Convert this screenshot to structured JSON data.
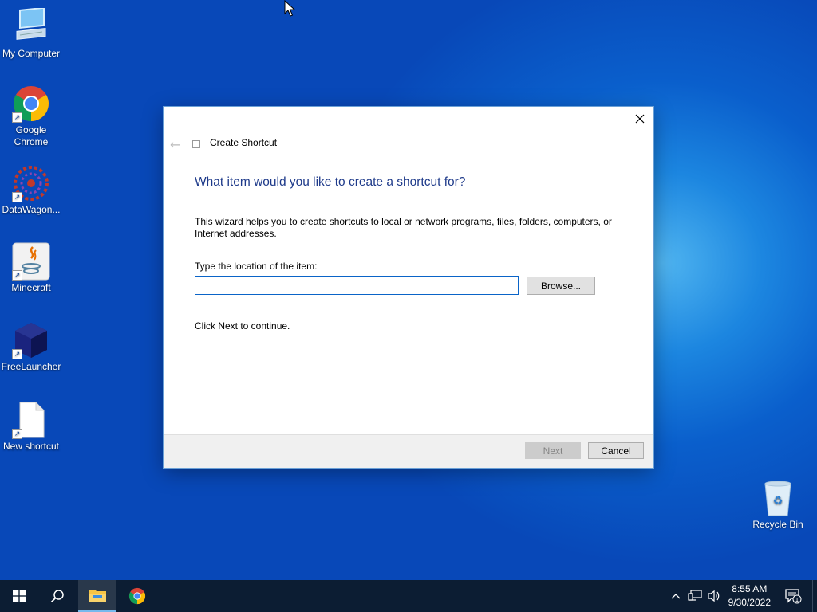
{
  "desktop": {
    "icons": [
      {
        "label": "My Computer",
        "icon": "computer-icon"
      },
      {
        "label": "Google Chrome",
        "icon": "chrome-icon"
      },
      {
        "label": "DataWagon...",
        "icon": "datawagon-icon"
      },
      {
        "label": "Minecraft",
        "icon": "java-icon"
      },
      {
        "label": "FreeLauncher",
        "icon": "cube-icon"
      },
      {
        "label": "New shortcut",
        "icon": "file-icon"
      },
      {
        "label": "Recycle Bin",
        "icon": "recycle-bin-icon"
      }
    ]
  },
  "dialog": {
    "title": "Create Shortcut",
    "heading": "What item would you like to create a shortcut for?",
    "description": "This wizard helps you to create shortcuts to local or network programs, files, folders, computers, or Internet addresses.",
    "field_label": "Type the location of the item:",
    "field_value": "",
    "browse_label": "Browse...",
    "continue_text": "Click Next to continue.",
    "next_label": "Next",
    "cancel_label": "Cancel"
  },
  "taskbar": {
    "time": "8:55 AM",
    "date": "9/30/2022",
    "notification_count": "1"
  },
  "colors": {
    "accent": "#0a64c8",
    "heading": "#1e3a8a",
    "taskbar": "#0c1d33"
  }
}
